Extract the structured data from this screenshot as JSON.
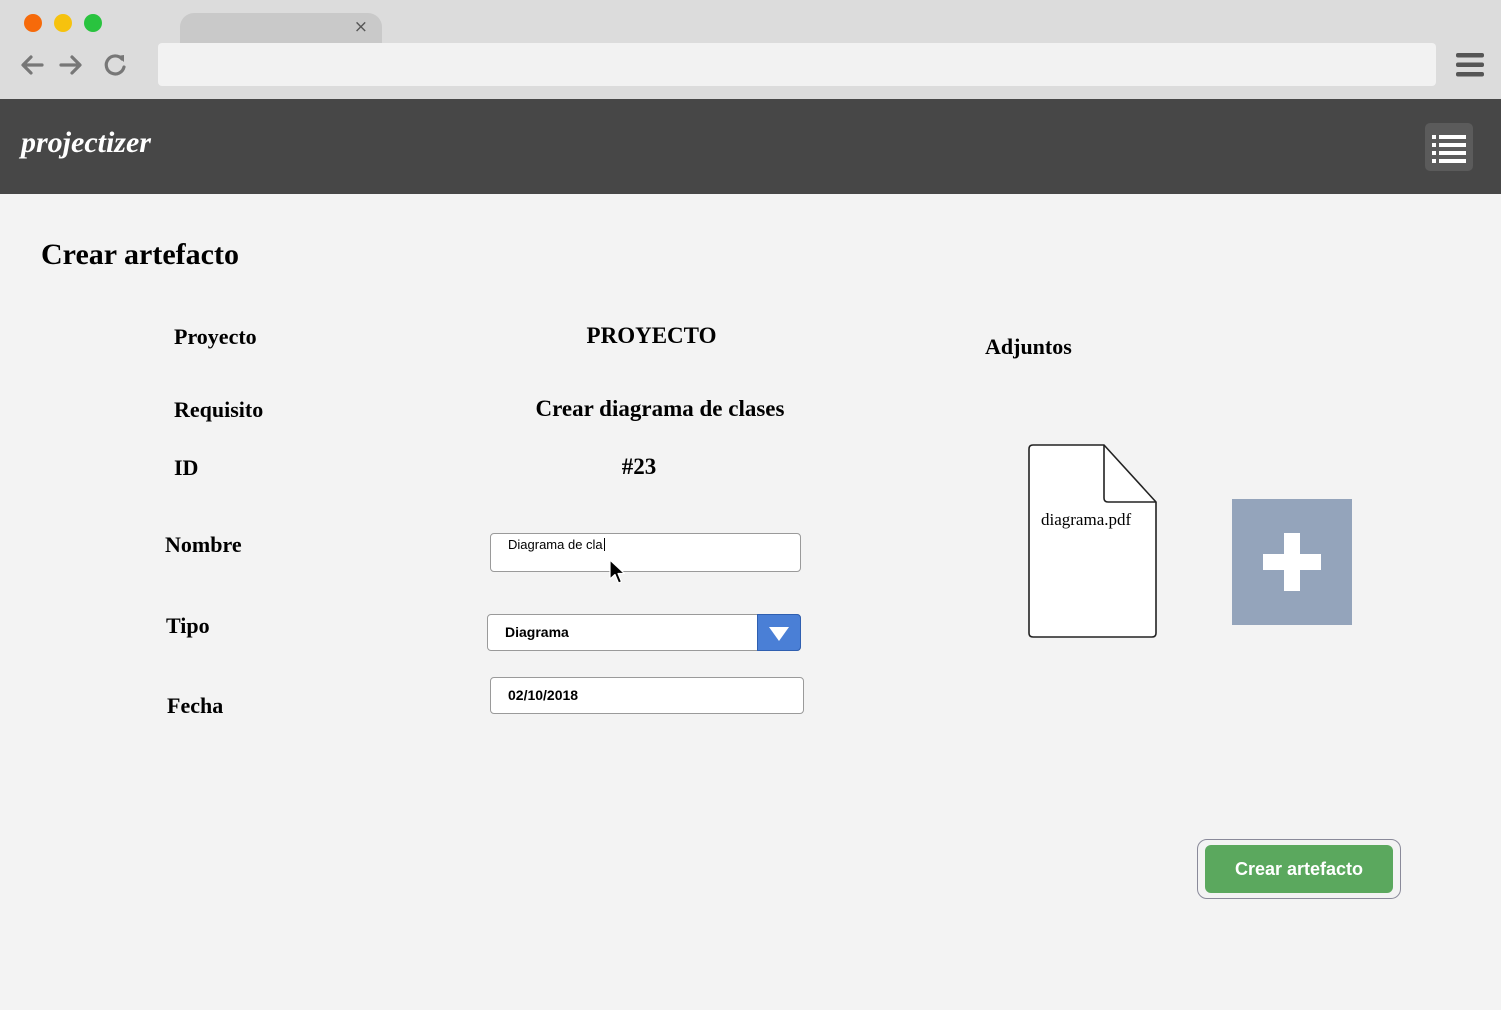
{
  "browser": {
    "tab_close": "×",
    "icons": [
      "back-arrow-icon",
      "forward-arrow-icon",
      "reload-icon",
      "hamburger-menu-icon"
    ]
  },
  "app": {
    "logo": "projectizer",
    "menu_icon": "list-icon"
  },
  "page": {
    "title": "Crear artefacto"
  },
  "form": {
    "proyecto": {
      "label": "Proyecto",
      "value": "PROYECTO"
    },
    "requisito": {
      "label": "Requisito",
      "value": "Crear diagrama de clases"
    },
    "id": {
      "label": "ID",
      "value": "#23"
    },
    "nombre": {
      "label": "Nombre",
      "value": "Diagrama de cla"
    },
    "tipo": {
      "label": "Tipo",
      "value": "Diagrama"
    },
    "fecha": {
      "label": "Fecha",
      "value": "02/10/2018"
    }
  },
  "attachments": {
    "label": "Adjuntos",
    "files": [
      {
        "name": "diagrama.pdf",
        "icon": "document-icon"
      }
    ],
    "add_icon": "plus-icon"
  },
  "actions": {
    "submit_label": "Crear artefacto"
  },
  "colors": {
    "header_bg": "#474747",
    "submit_bg": "#5ba85e",
    "add_bg": "#94a4bb",
    "select_arrow_bg": "#4a7fd6"
  }
}
